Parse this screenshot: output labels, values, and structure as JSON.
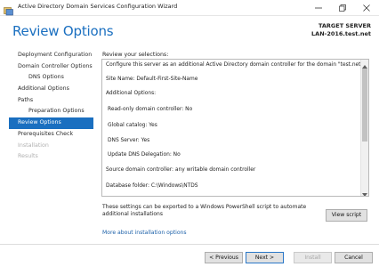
{
  "window": {
    "title": "Active Directory Domain Services Configuration Wizard",
    "icons": {
      "app": "ad-wizard-icon",
      "minimize": "minimize-icon",
      "maximize": "restore-icon",
      "close": "close-icon"
    }
  },
  "header": {
    "page_title": "Review Options",
    "target_label": "TARGET SERVER",
    "target_name": "LAN-2016.test.net"
  },
  "nav": {
    "items": [
      {
        "label": "Deployment Configuration",
        "state": "normal"
      },
      {
        "label": "Domain Controller Options",
        "state": "normal"
      },
      {
        "label": "DNS Options",
        "state": "normal"
      },
      {
        "label": "Additional Options",
        "state": "normal"
      },
      {
        "label": "Paths",
        "state": "normal"
      },
      {
        "label": "Preparation Options",
        "state": "normal"
      },
      {
        "label": "Review Options",
        "state": "selected"
      },
      {
        "label": "Prerequisites Check",
        "state": "normal"
      },
      {
        "label": "Installation",
        "state": "disabled"
      },
      {
        "label": "Results",
        "state": "disabled"
      }
    ]
  },
  "main": {
    "selections_label": "Review your selections:",
    "review_lines": [
      "Configure this server as an additional Active Directory domain controller for the domain \"test.net\".",
      "Site Name: Default-First-Site-Name",
      "Additional Options:",
      "Read-only domain controller: No",
      "Global catalog: Yes",
      "DNS Server: Yes",
      "Update DNS Delegation: No",
      "Source domain controller: any writable domain controller",
      "Database folder: C:\\Windows\\NTDS"
    ],
    "export_note": "These settings can be exported to a Windows PowerShell script to automate additional installations",
    "view_script_label": "View script",
    "more_link": "More about installation options"
  },
  "footer": {
    "previous_label": "< Previous",
    "next_label": "Next >",
    "install_label": "Install",
    "cancel_label": "Cancel"
  },
  "colors": {
    "accent": "#1a6fc0",
    "link": "#1a5fa8",
    "disabled_text": "#b0b0b0"
  }
}
